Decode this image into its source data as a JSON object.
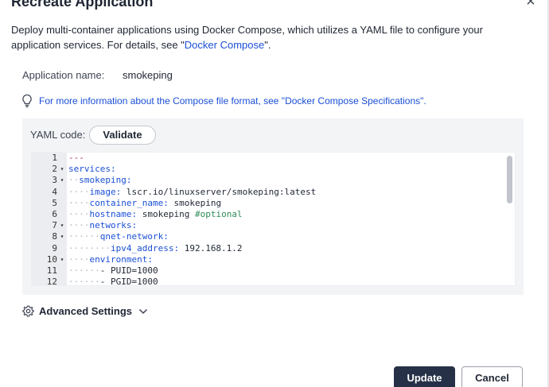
{
  "dialog": {
    "title": "Recreate Application",
    "close_label": "×"
  },
  "description": {
    "text_before": "Deploy multi-container applications using Docker Compose, which utilizes a YAML file to configure your application services. For details, see \"",
    "link": "Docker Compose",
    "text_after": "\"."
  },
  "app_name": {
    "label": "Application name:",
    "value": "smokeping"
  },
  "hint": {
    "text_before": "For more information about the Compose file format, see \"",
    "link": "Docker Compose Specifications",
    "text_after": "\"."
  },
  "yaml": {
    "label": "YAML code:",
    "validate_label": "Validate",
    "lines": [
      {
        "n": "1",
        "fold": "",
        "ws": "",
        "key": "",
        "val": "---",
        "comment": "",
        "kind": "doc"
      },
      {
        "n": "2",
        "fold": "▾",
        "ws": "",
        "key": "services:",
        "val": "",
        "comment": ""
      },
      {
        "n": "3",
        "fold": "▾",
        "ws": "··",
        "key": "smokeping:",
        "val": "",
        "comment": ""
      },
      {
        "n": "4",
        "fold": "",
        "ws": "····",
        "key": "image:",
        "val": " lscr.io/linuxserver/smokeping:latest",
        "comment": ""
      },
      {
        "n": "5",
        "fold": "",
        "ws": "····",
        "key": "container_name:",
        "val": " smokeping",
        "comment": ""
      },
      {
        "n": "6",
        "fold": "",
        "ws": "····",
        "key": "hostname:",
        "val": " smokeping ",
        "comment": "#optional"
      },
      {
        "n": "7",
        "fold": "▾",
        "ws": "····",
        "key": "networks:",
        "val": "",
        "comment": ""
      },
      {
        "n": "8",
        "fold": "▾",
        "ws": "······",
        "key": "qnet-network:",
        "val": "",
        "comment": ""
      },
      {
        "n": "9",
        "fold": "",
        "ws": "········",
        "key": "ipv4_address:",
        "val": " 192.168.1.2",
        "comment": ""
      },
      {
        "n": "10",
        "fold": "▾",
        "ws": "····",
        "key": "environment:",
        "val": "",
        "comment": ""
      },
      {
        "n": "11",
        "fold": "",
        "ws": "······",
        "key": "",
        "val": "- PUID=1000",
        "comment": ""
      },
      {
        "n": "12",
        "fold": "",
        "ws": "······",
        "key": "",
        "val": "- PGID=1000",
        "comment": ""
      }
    ]
  },
  "advanced_settings": {
    "label": "Advanced Settings"
  },
  "actions": {
    "update_label": "Update",
    "cancel_label": "Cancel"
  },
  "colors": {
    "primary_button": "#263147",
    "link": "#1a4fd6",
    "yaml_key": "#1a4fd6",
    "yaml_doc_marker": "#b9266d",
    "yaml_comment": "#2e8b57"
  },
  "icons": {
    "hint": "lightbulb-icon",
    "advanced": "gear-icon",
    "advanced_toggle": "chevron-down-icon",
    "close": "close-icon"
  }
}
